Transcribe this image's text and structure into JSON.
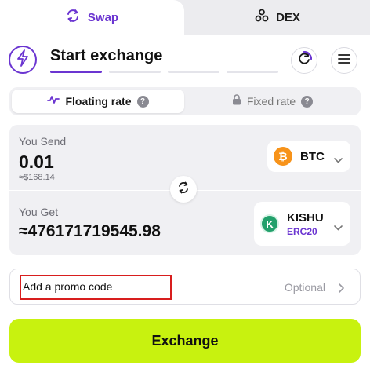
{
  "tabs": {
    "swap_label": "Swap",
    "dex_label": "DEX"
  },
  "header": {
    "title": "Start exchange",
    "steps_total": 4,
    "active_step": 1
  },
  "rate": {
    "floating_label": "Floating rate",
    "fixed_label": "Fixed rate",
    "selected": "floating",
    "help_glyph": "?"
  },
  "send": {
    "label": "You Send",
    "amount": "0.01",
    "usd": "≈$168.14",
    "coin": {
      "code": "BTC",
      "icon_glyph": "₿",
      "color": "#f7931a"
    }
  },
  "get": {
    "label": "You Get",
    "amount": "≈476171719545.98",
    "coin": {
      "code": "KISHU",
      "network": "ERC20",
      "icon_glyph": "K",
      "color": "#22a06b"
    }
  },
  "promo": {
    "label": "Add a promo code",
    "optional": "Optional"
  },
  "action": {
    "exchange_label": "Exchange"
  },
  "colors": {
    "accent": "#6b35d1",
    "button": "#c8f20f",
    "highlight": "#d81e1e"
  },
  "icons": [
    "swap-arrows-icon",
    "dex-nodes-icon",
    "lightning-icon",
    "refresh-icon",
    "menu-icon",
    "chart-wave-icon",
    "lock-icon",
    "help-icon",
    "swap-vertical-icon",
    "chevron-down-icon",
    "chevron-right-icon"
  ]
}
